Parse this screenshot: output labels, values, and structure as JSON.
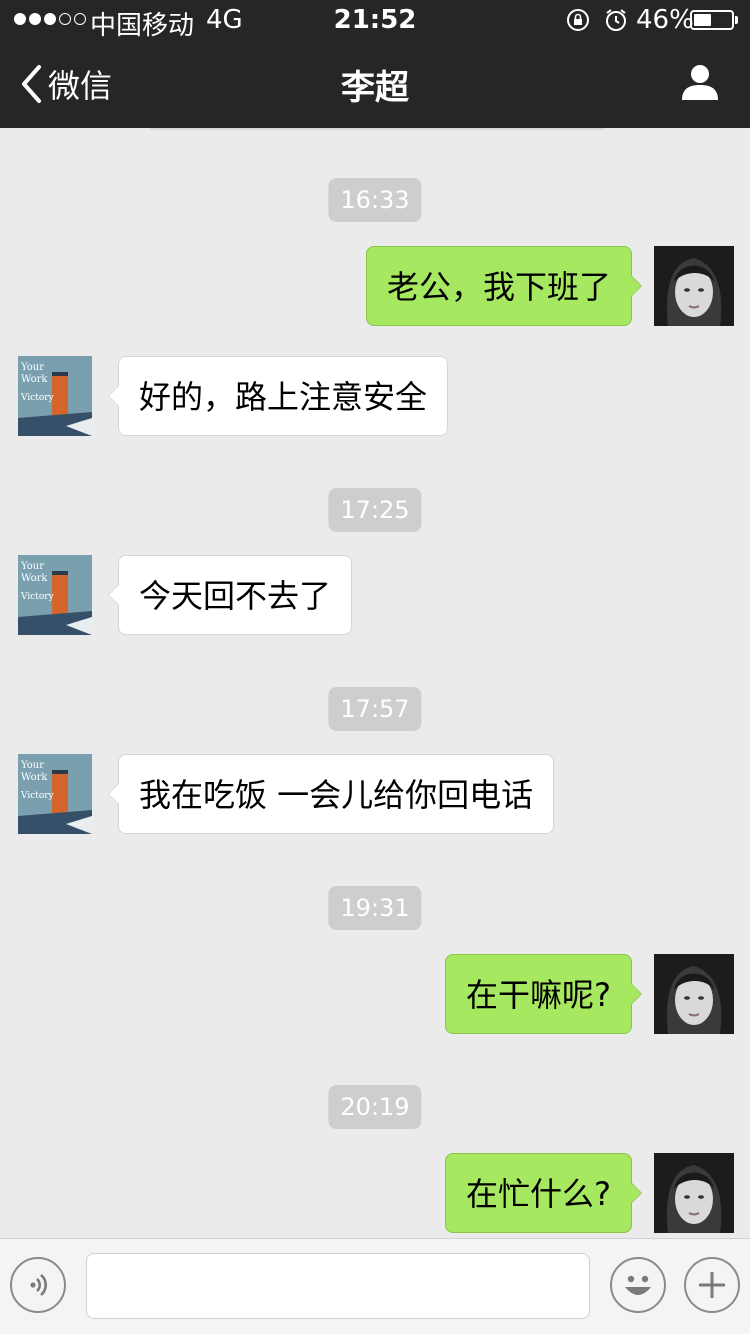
{
  "status_bar": {
    "carrier": "中国移动",
    "network": "4G",
    "time": "21:52",
    "battery_percent_label": "46%",
    "battery_level": 0.46
  },
  "nav": {
    "back_label": "微信",
    "title": "李超"
  },
  "messages": {
    "t1": "16:33",
    "m1": "老公，我下班了",
    "m2": "好的，路上注意安全",
    "t2": "17:25",
    "m3": "今天回不去了",
    "t3": "17:57",
    "m4": "我在吃饭 一会儿给你回电话",
    "t4": "19:31",
    "m5": "在干嘛呢?",
    "t5": "20:19",
    "m6": "在忙什么?"
  },
  "contact_avatar_text": [
    "Your",
    "Work",
    "Victory"
  ],
  "input": {
    "value": "",
    "placeholder": ""
  },
  "colors": {
    "bar_bg": "#262628",
    "chat_bg": "#ebebeb",
    "sent_bubble": "#a6e860",
    "received_bubble": "#ffffff",
    "time_chip": "#cecece"
  }
}
